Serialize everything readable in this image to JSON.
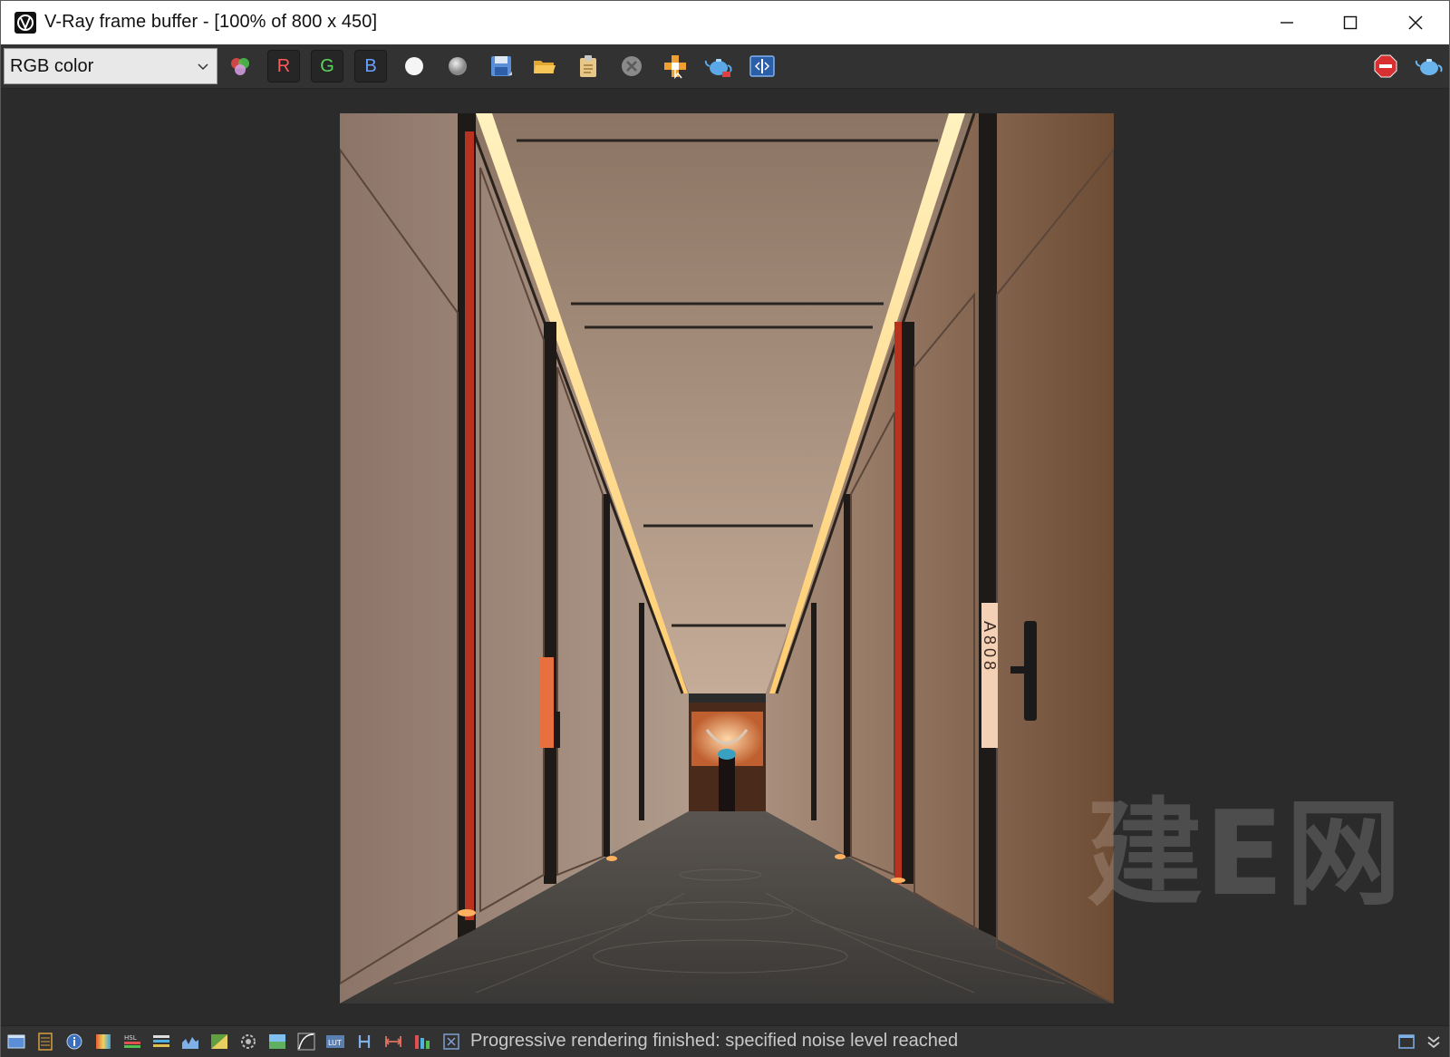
{
  "window": {
    "title": "V-Ray frame buffer - [100% of 800 x 450]"
  },
  "toolbar": {
    "channel_select": "RGB color",
    "channel_buttons": {
      "r": "R",
      "g": "G",
      "b": "B"
    },
    "icons": [
      "color-channels-icon",
      "white-dot-icon",
      "gray-dot-icon",
      "save-image-icon",
      "open-folder-icon",
      "clipboard-icon",
      "clear-image-icon",
      "track-mouse-icon",
      "render-teapot-icon",
      "compare-icon",
      "stop-render-icon",
      "render-region-teapot-icon"
    ],
    "accent_colors": {
      "r": "#ff5a5a",
      "g": "#5cd65c",
      "b": "#6aa0ff"
    }
  },
  "render": {
    "door_sign": "A808"
  },
  "watermark": "建E网",
  "statusbar": {
    "message": "Progressive rendering finished: specified noise level reached",
    "icons": [
      "display-window-icon",
      "history-icon",
      "info-icon",
      "color-correction-icon",
      "hsl-icon",
      "levels-icon",
      "histogram-icon",
      "exposure-icon",
      "lens-effects-icon",
      "background-icon",
      "curves-icon",
      "lut-icon",
      "hue-icon",
      "white-balance-icon",
      "channel-balance-icon",
      "stamp-icon",
      "restore-panel-icon",
      "expand-icon"
    ]
  }
}
